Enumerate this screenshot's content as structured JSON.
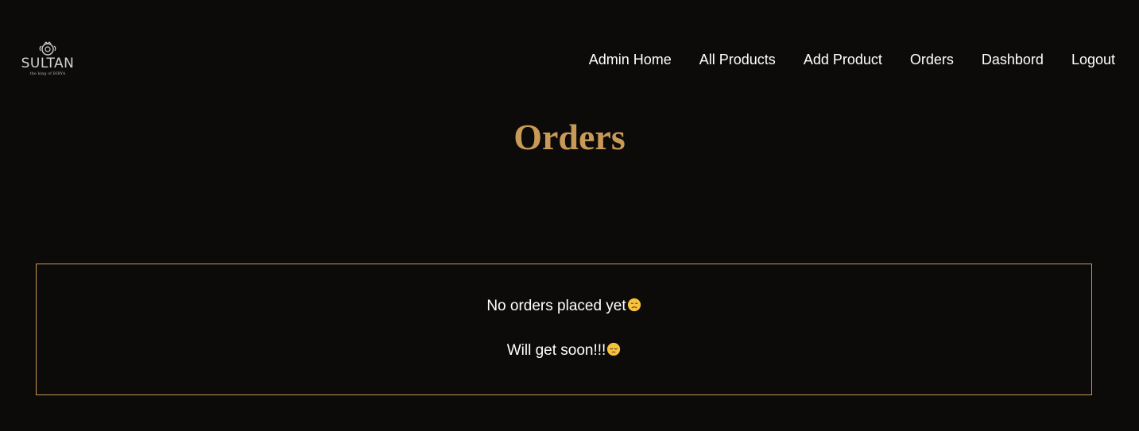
{
  "brand": {
    "name": "SULTAN",
    "tagline": "the king of BIRYA"
  },
  "nav": {
    "items": [
      {
        "label": "Admin Home"
      },
      {
        "label": "All Products"
      },
      {
        "label": "Add Product"
      },
      {
        "label": "Orders"
      },
      {
        "label": "Dashbord"
      },
      {
        "label": "Logout"
      }
    ]
  },
  "page": {
    "title": "Orders"
  },
  "empty_state": {
    "line1": "No orders placed yet",
    "line1_emoji": "disappointed-face-icon",
    "line2": "Will get soon!!!",
    "line2_emoji": "pensive-face-icon"
  },
  "colors": {
    "background": "#0c0b09",
    "accent": "#c89a58",
    "text": "#ffffff"
  }
}
